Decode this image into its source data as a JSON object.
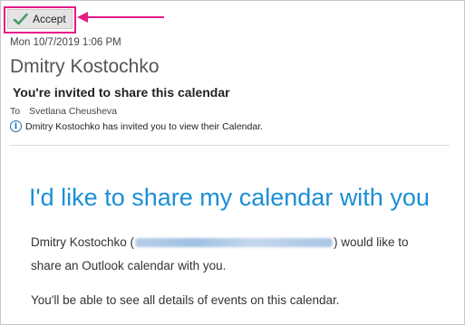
{
  "toolbar": {
    "accept_label": "Accept"
  },
  "message": {
    "date": "Mon 10/7/2019 1:06 PM",
    "sender": "Dmitry Kostochko",
    "subject": "You're invited to share this calendar",
    "to_label": "To",
    "recipient": "Svetlana Cheusheva",
    "info_text": "Dmitry Kostochko has invited you to view their Calendar."
  },
  "body": {
    "headline": "I'd like to share my calendar with you",
    "p1_before": "Dmitry Kostochko (",
    "p1_after": ") would like to",
    "p1_line2": "share an Outlook calendar with you.",
    "p2": "You'll be able to see all details of events on this calendar."
  },
  "colors": {
    "accent": "#1b8fd6",
    "highlight": "#e8198a",
    "check": "#4a9a6a"
  },
  "icons": {
    "accept": "checkmark-icon",
    "info": "info-icon",
    "annotation": "arrow-left-icon"
  }
}
